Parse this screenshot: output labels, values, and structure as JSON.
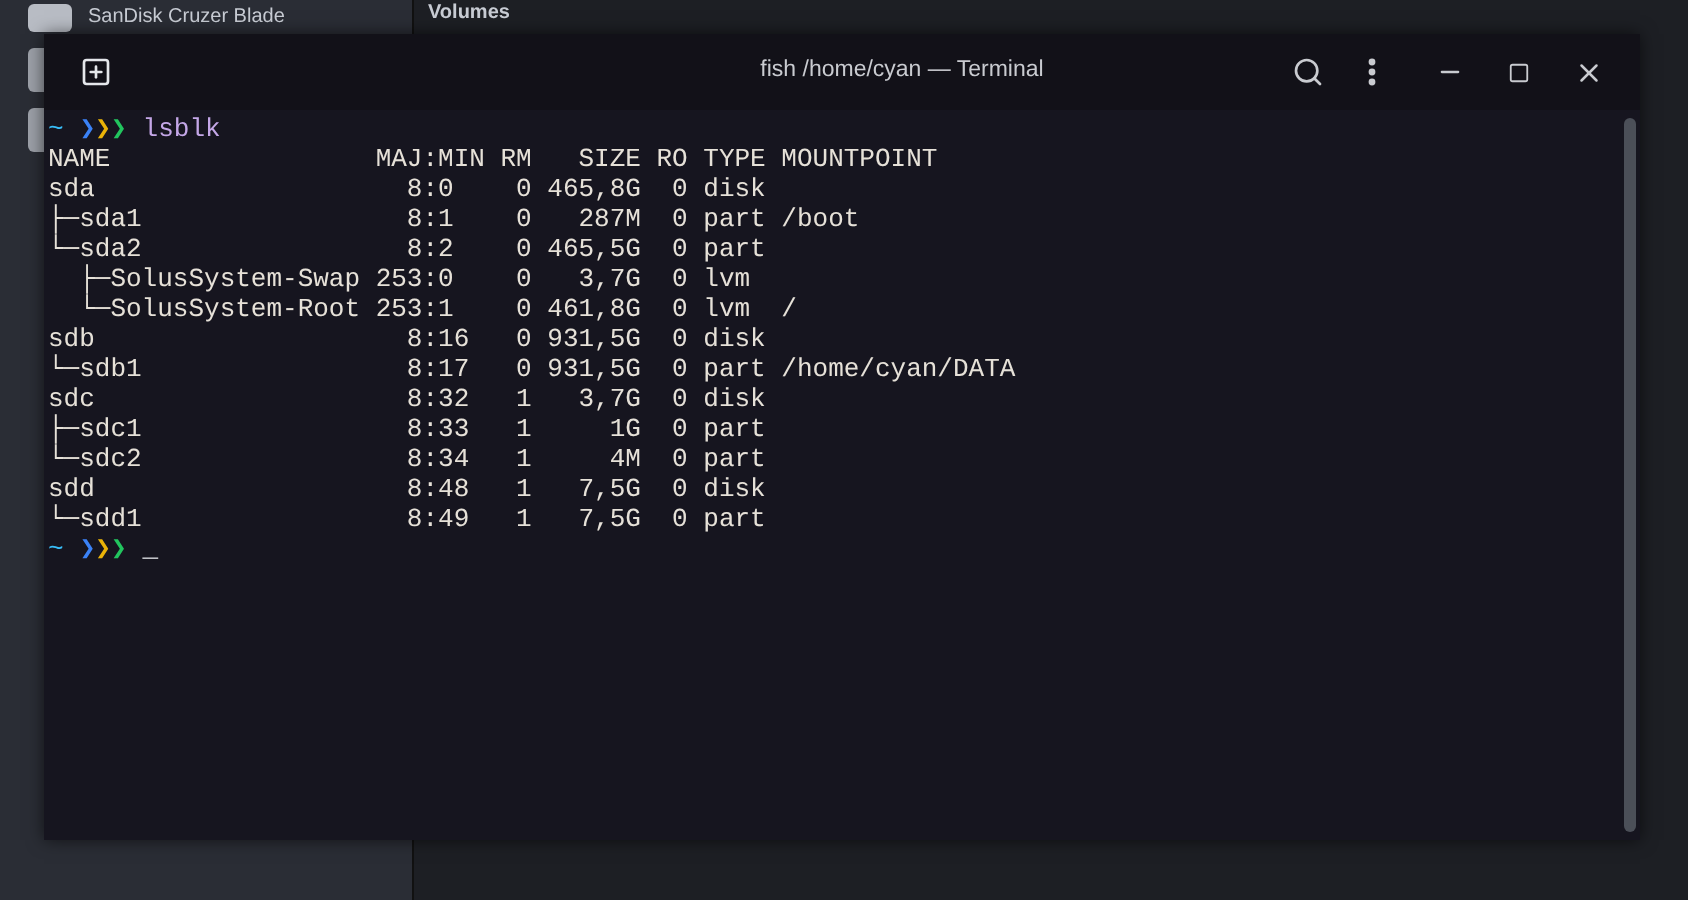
{
  "background_window": {
    "device_item": "SanDisk Cruzer Blade",
    "section_heading": "Volumes"
  },
  "terminal": {
    "title": "fish /home/cyan — Terminal",
    "lines": [
      {
        "kind": "prompt",
        "cwd": "~",
        "arrows": [
          {
            "glyph": "❯",
            "color": "#3b82f6"
          },
          {
            "glyph": "❯",
            "color": "#eab308"
          },
          {
            "glyph": "❯",
            "color": "#22c55e"
          }
        ],
        "command": "lsblk"
      },
      {
        "kind": "output",
        "text": "NAME                 MAJ:MIN RM   SIZE RO TYPE MOUNTPOINT"
      },
      {
        "kind": "output",
        "text": "sda                    8:0    0 465,8G  0 disk"
      },
      {
        "kind": "output",
        "text": "├─sda1                 8:1    0   287M  0 part /boot"
      },
      {
        "kind": "output",
        "text": "└─sda2                 8:2    0 465,5G  0 part"
      },
      {
        "kind": "output",
        "text": "  ├─SolusSystem-Swap 253:0    0   3,7G  0 lvm"
      },
      {
        "kind": "output",
        "text": "  └─SolusSystem-Root 253:1    0 461,8G  0 lvm  /"
      },
      {
        "kind": "output",
        "text": "sdb                    8:16   0 931,5G  0 disk"
      },
      {
        "kind": "output",
        "text": "└─sdb1                 8:17   0 931,5G  0 part /home/cyan/DATA"
      },
      {
        "kind": "output",
        "text": "sdc                    8:32   1   3,7G  0 disk"
      },
      {
        "kind": "output",
        "text": "├─sdc1                 8:33   1     1G  0 part"
      },
      {
        "kind": "output",
        "text": "└─sdc2                 8:34   1     4M  0 part"
      },
      {
        "kind": "output",
        "text": "sdd                    8:48   1   7,5G  0 disk"
      },
      {
        "kind": "output",
        "text": "└─sdd1                 8:49   1   7,5G  0 part"
      },
      {
        "kind": "prompt",
        "cwd": "~",
        "arrows": [
          {
            "glyph": "❯",
            "color": "#3b82f6"
          },
          {
            "glyph": "❯",
            "color": "#eab308"
          },
          {
            "glyph": "❯",
            "color": "#22c55e"
          }
        ],
        "cursor": "_"
      }
    ]
  }
}
